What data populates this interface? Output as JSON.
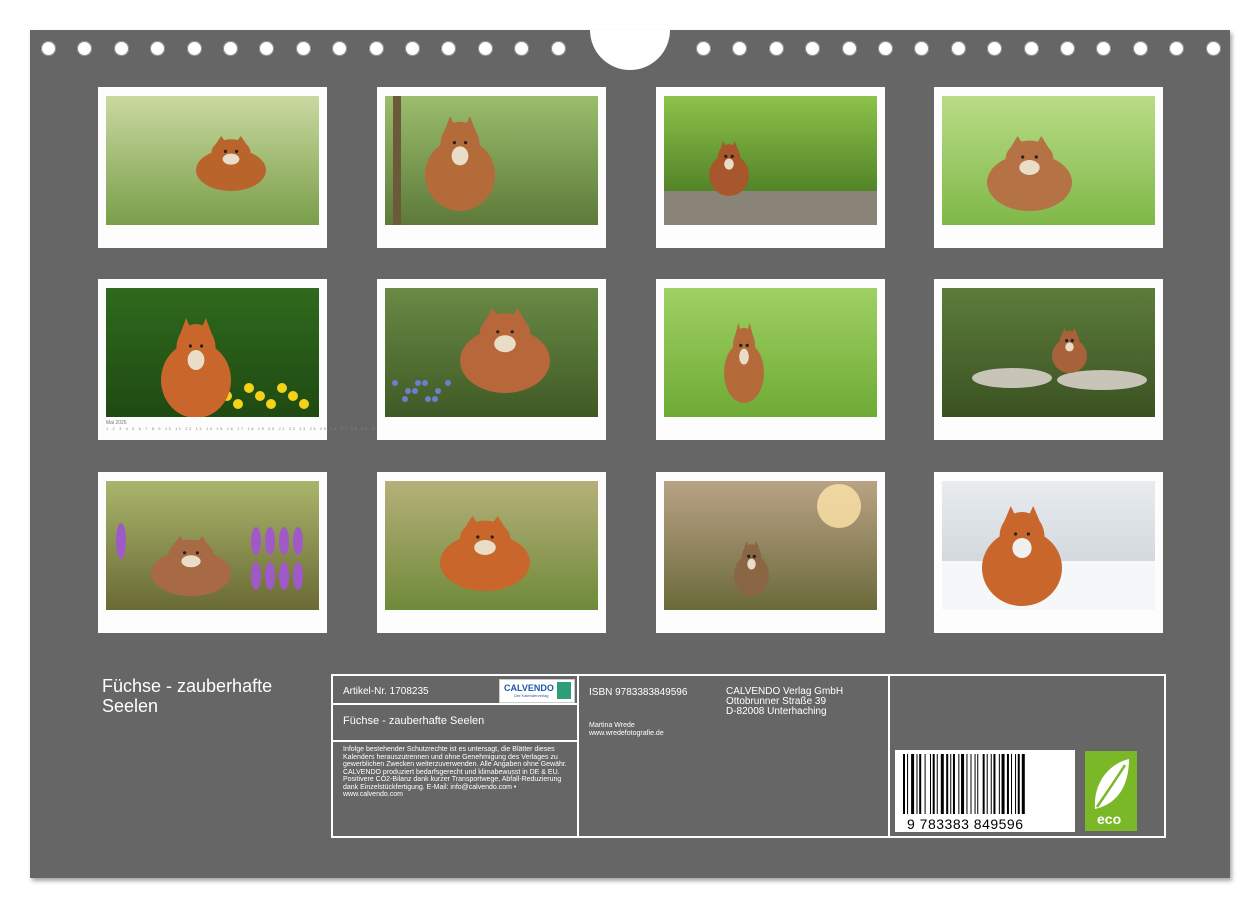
{
  "calendar_sheet": {
    "product_title_line1": "Füchse - zauberhafte",
    "product_title_line2": "Seelen",
    "photos": [
      {
        "name": "fox-standing-meadow"
      },
      {
        "name": "fox-kit-forest"
      },
      {
        "name": "fox-on-path"
      },
      {
        "name": "fox-kit-grass"
      },
      {
        "name": "fox-dandelions",
        "calendar_month": "Mai 2025",
        "calendar_days": "1 2 3 4 5 6 7 8 9 10 11 12 13 14 15 16 17 18 19 20 21 22 23 24 25 26 27 28 29 30 31"
      },
      {
        "name": "fox-kit-flowers"
      },
      {
        "name": "fox-kit-sitting"
      },
      {
        "name": "fox-behind-stones"
      },
      {
        "name": "fox-purple-flowers"
      },
      {
        "name": "fox-lying-meadow"
      },
      {
        "name": "fox-kit-sunset"
      },
      {
        "name": "fox-snow"
      }
    ]
  },
  "info_box": {
    "article_no": "Artikel-Nr. 1708235",
    "logo_text": "CALVENDO",
    "logo_sub": "Der Kalenderverlag",
    "book_title": "Füchse - zauberhafte Seelen",
    "legal_text": "Infolge bestehender Schutzrechte ist es untersagt, die Blätter dieses Kalenders herauszutrennen und ohne Genehmigung des Verlages zu gewerblichen Zwecken weiterzuverwenden. Alle Angaben ohne Gewähr. CALVENDO produziert bedarfsgerecht und klimabewusst in DE & EU. Positivere CO2-Bilanz dank kurzer Transportwege, Abfall-Reduzierung dank Einzelstückfertigung. E-Mail: info@calvendo.com • www.calvendo.com",
    "isbn": "ISBN 9783383849596",
    "author": "Martina Wrede",
    "author_url": "www.wredefotografie.de",
    "publisher_line1": "CALVENDO Verlag GmbH",
    "publisher_line2": "Ottobrunner Straße 39",
    "publisher_line3": "D-82008 Unterhaching",
    "barcode_digits": "9 783383 849596",
    "eco_label": "eco"
  },
  "colors": {
    "sheet": "#666666",
    "frame": "#fdfdfd",
    "eco_green": "#7ab827"
  }
}
